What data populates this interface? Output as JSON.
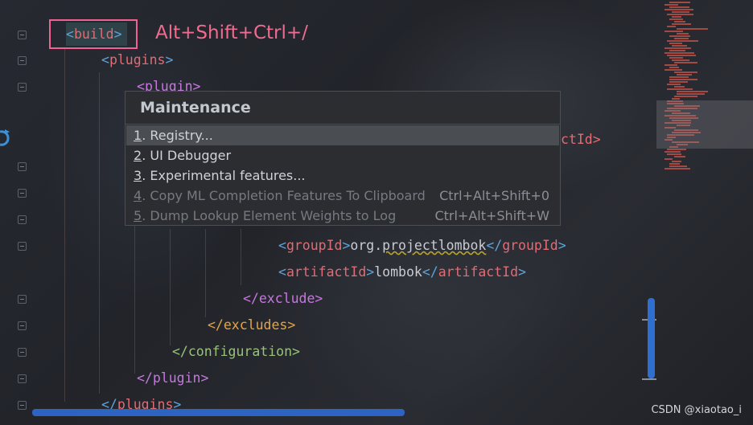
{
  "editor": {
    "annotation": "Alt+Shift+Ctrl+/",
    "lines": {
      "build": {
        "open": "<",
        "name": "build",
        "close": ">"
      },
      "plugins": {
        "open": "<",
        "name": "plugins",
        "close": ">"
      },
      "plugin": {
        "open": "<",
        "name": "plugin",
        "close": ">"
      },
      "artifact_tail": {
        "text": "ctId>"
      },
      "groupId": {
        "open": "<",
        "name": "groupId",
        "mid": ">",
        "value_pre": "org.",
        "value_word": "projectlombok",
        "end_open": "</",
        "end_name": "groupId",
        "end_close": ">"
      },
      "artifactId": {
        "open": "<",
        "name": "artifactId",
        "mid": ">",
        "value": "lombok",
        "end_open": "</",
        "end_name": "artifactId",
        "end_close": ">"
      },
      "exclude_close": {
        "open": "</",
        "name": "exclude",
        "close": ">"
      },
      "excludes_close": {
        "open": "</",
        "name": "excludes",
        "close": ">"
      },
      "configuration_close": {
        "open": "</",
        "name": "configuration",
        "close": ">"
      },
      "plugin_close": {
        "open": "</",
        "name": "plugin",
        "close": ">"
      },
      "plugins_close": {
        "open": "</",
        "name": "plugins",
        "close": ">"
      }
    }
  },
  "popup": {
    "title": "Maintenance",
    "items": [
      {
        "num": "1",
        "label": ". Registry...",
        "shortcut": "",
        "disabled": false,
        "selected": true
      },
      {
        "num": "2",
        "label": ". UI Debugger",
        "shortcut": "",
        "disabled": false,
        "selected": false
      },
      {
        "num": "3",
        "label": ". Experimental features...",
        "shortcut": "",
        "disabled": false,
        "selected": false
      },
      {
        "num": "4",
        "label": ". Copy ML Completion Features To Clipboard",
        "shortcut": "Ctrl+Alt+Shift+0",
        "disabled": true,
        "selected": false
      },
      {
        "num": "5",
        "label": ". Dump Lookup Element Weights to Log",
        "shortcut": "Ctrl+Alt+Shift+W",
        "disabled": true,
        "selected": false
      }
    ]
  },
  "watermark": "CSDN @xiaotao_i",
  "colors": {
    "annotation": "#ef6b8f",
    "accent_scroll": "#2f6fd0",
    "background": "#23252b"
  }
}
